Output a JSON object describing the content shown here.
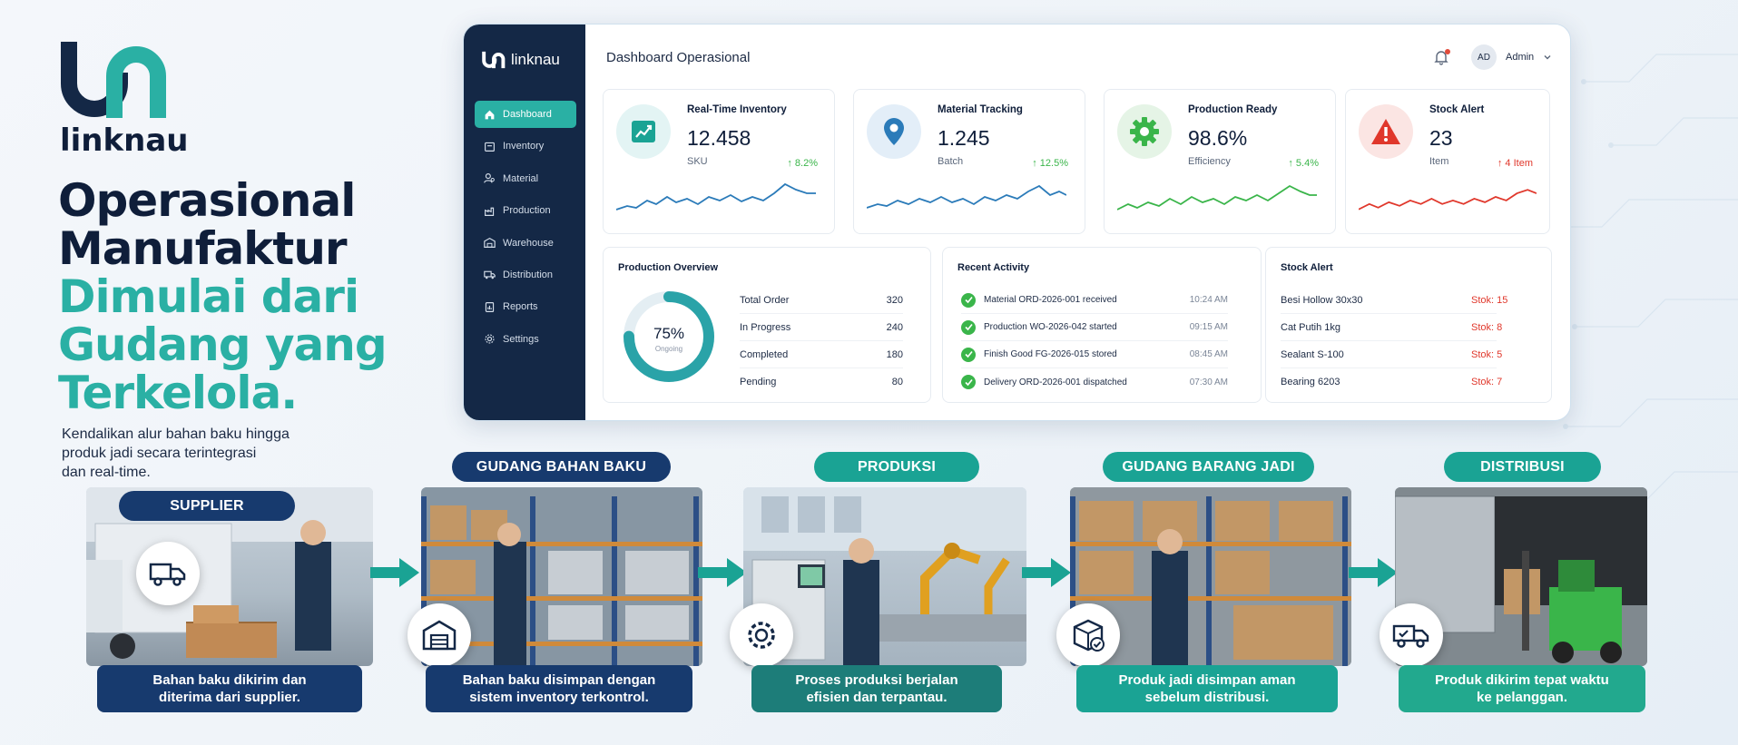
{
  "brand": {
    "name": "linknau"
  },
  "hero": {
    "line1": "Operasional",
    "line2": "Manufaktur",
    "line3": "Dimulai dari",
    "line4": "Gudang yang",
    "line5": "Terkelola.",
    "subtitle_1": "Kendalikan alur bahan baku hingga",
    "subtitle_2": "produk jadi secara terintegrasi",
    "subtitle_3": "dan real-time."
  },
  "colors": {
    "navy": "#142846",
    "teal": "#2ab0a4",
    "green": "#3ab54a",
    "red": "#e0372b",
    "flow_teal": "#1aa394"
  },
  "dashboard": {
    "sidebar": {
      "logo": "linknau",
      "items": [
        {
          "label": "Dashboard",
          "icon": "home-icon"
        },
        {
          "label": "Inventory",
          "icon": "box-icon"
        },
        {
          "label": "Material",
          "icon": "material-icon"
        },
        {
          "label": "Production",
          "icon": "factory-icon"
        },
        {
          "label": "Warehouse",
          "icon": "warehouse-icon"
        },
        {
          "label": "Distribution",
          "icon": "truck-icon"
        },
        {
          "label": "Reports",
          "icon": "report-icon"
        },
        {
          "label": "Settings",
          "icon": "gear-icon"
        }
      ]
    },
    "title": "Dashboard Operasional",
    "user": {
      "initials": "AD",
      "name": "Admin"
    },
    "kpis": [
      {
        "label": "Real-Time Inventory",
        "value": "12.458",
        "unit": "SKU",
        "trend": "↑ 8.2%",
        "icon": "chart-icon"
      },
      {
        "label": "Material Tracking",
        "value": "1.245",
        "unit": "Batch",
        "trend": "↑ 12.5%",
        "icon": "location-pin-icon"
      },
      {
        "label": "Production Ready",
        "value": "98.6%",
        "unit": "Efficiency",
        "trend": "↑ 5.4%",
        "icon": "gear-icon"
      },
      {
        "label": "Stock Alert",
        "value": "23",
        "unit": "Item",
        "trend": "↑ 4 Item",
        "icon": "warning-icon"
      }
    ],
    "production_overview": {
      "title": "Production Overview",
      "percent": "75%",
      "percent_value": 0.75,
      "percent_label": "Ongoing",
      "rows": [
        {
          "label": "Total Order",
          "value": "320"
        },
        {
          "label": "In Progress",
          "value": "240"
        },
        {
          "label": "Completed",
          "value": "180"
        },
        {
          "label": "Pending",
          "value": "80"
        }
      ]
    },
    "recent_activity": {
      "title": "Recent Activity",
      "rows": [
        {
          "text": "Material ORD-2026-001 received",
          "time": "10:24 AM"
        },
        {
          "text": "Production WO-2026-042 started",
          "time": "09:15 AM"
        },
        {
          "text": "Finish Good FG-2026-015 stored",
          "time": "08:45 AM"
        },
        {
          "text": "Delivery ORD-2026-001 dispatched",
          "time": "07:30 AM"
        }
      ]
    },
    "stock_alert": {
      "title": "Stock Alert",
      "rows": [
        {
          "name": "Besi Hollow 30x30",
          "stock": "Stok: 15"
        },
        {
          "name": "Cat Putih 1kg",
          "stock": "Stok: 8"
        },
        {
          "name": "Sealant S-100",
          "stock": "Stok: 5"
        },
        {
          "name": "Bearing 6203",
          "stock": "Stok: 7"
        }
      ]
    }
  },
  "flow": {
    "steps": [
      {
        "title": "SUPPLIER",
        "caption_1": "Bahan baku dikirim dan",
        "caption_2": "diterima dari supplier.",
        "icon": "truck-icon"
      },
      {
        "title": "GUDANG BAHAN BAKU",
        "caption_1": "Bahan baku disimpan dengan",
        "caption_2": "sistem inventory terkontrol.",
        "icon": "warehouse-icon"
      },
      {
        "title": "PRODUKSI",
        "caption_1": "Proses produksi berjalan",
        "caption_2": "efisien dan terpantau.",
        "icon": "gear-icon"
      },
      {
        "title": "GUDANG BARANG JADI",
        "caption_1": "Produk jadi disimpan aman",
        "caption_2": "sebelum distribusi.",
        "icon": "box-check-icon"
      },
      {
        "title": "DISTRIBUSI",
        "caption_1": "Produk dikirim tepat waktu",
        "caption_2": "ke pelanggan.",
        "icon": "delivery-check-icon"
      }
    ]
  }
}
